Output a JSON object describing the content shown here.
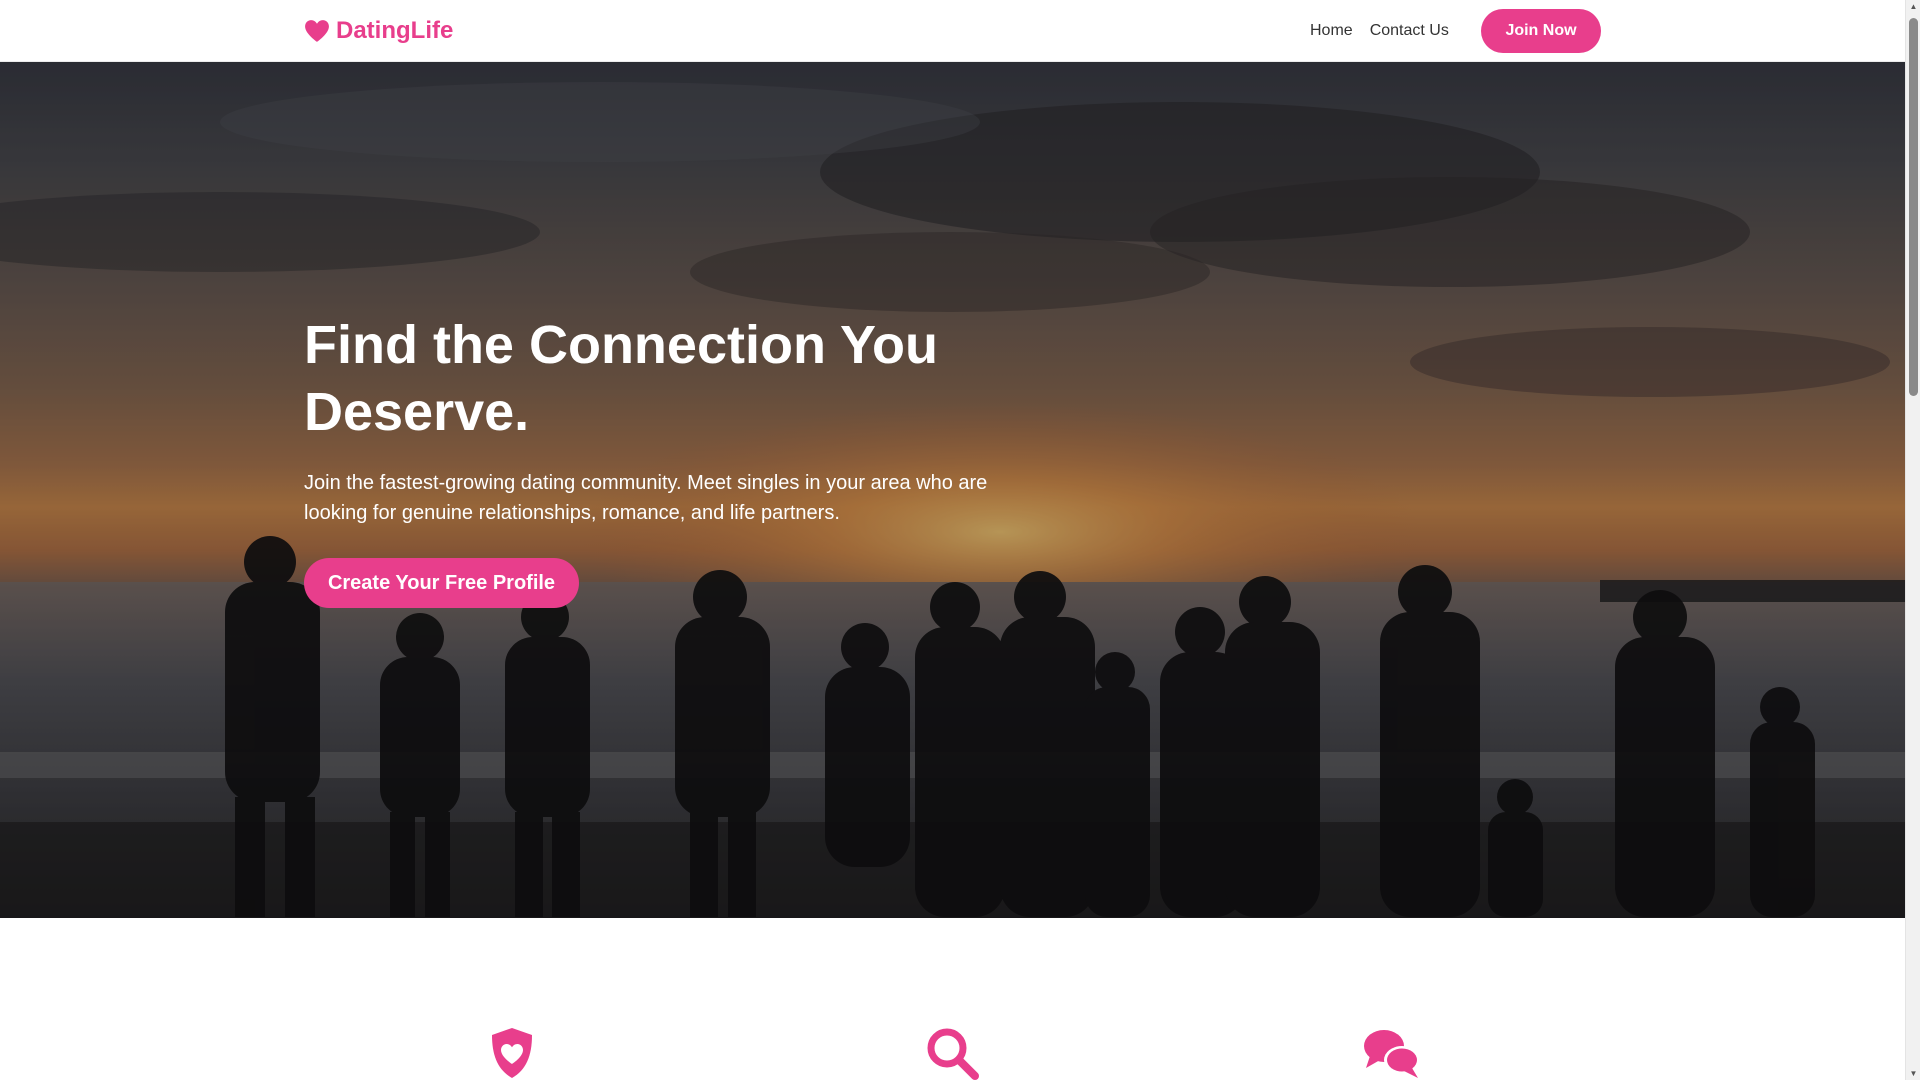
{
  "navbar": {
    "brand": {
      "icon": "heart-icon",
      "text": "DatingLife"
    },
    "links": [
      {
        "label": "Home"
      },
      {
        "label": "Contact Us"
      }
    ],
    "join_label": "Join Now"
  },
  "hero": {
    "title": "Find the Connection You Deserve.",
    "subtitle": "Join the fastest-growing dating community. Meet singles in your area who are looking for genuine relationships, romance, and life partners.",
    "cta_label": "Create Your Free Profile",
    "background": "sunset-beach-silhouettes-photo"
  },
  "features": {
    "icons": [
      "shield-heart-icon",
      "search-icon",
      "chat-bubbles-icon"
    ]
  },
  "colors": {
    "accent": "#e83e8c",
    "nav_text": "#333333",
    "hero_text": "#ffffff"
  }
}
